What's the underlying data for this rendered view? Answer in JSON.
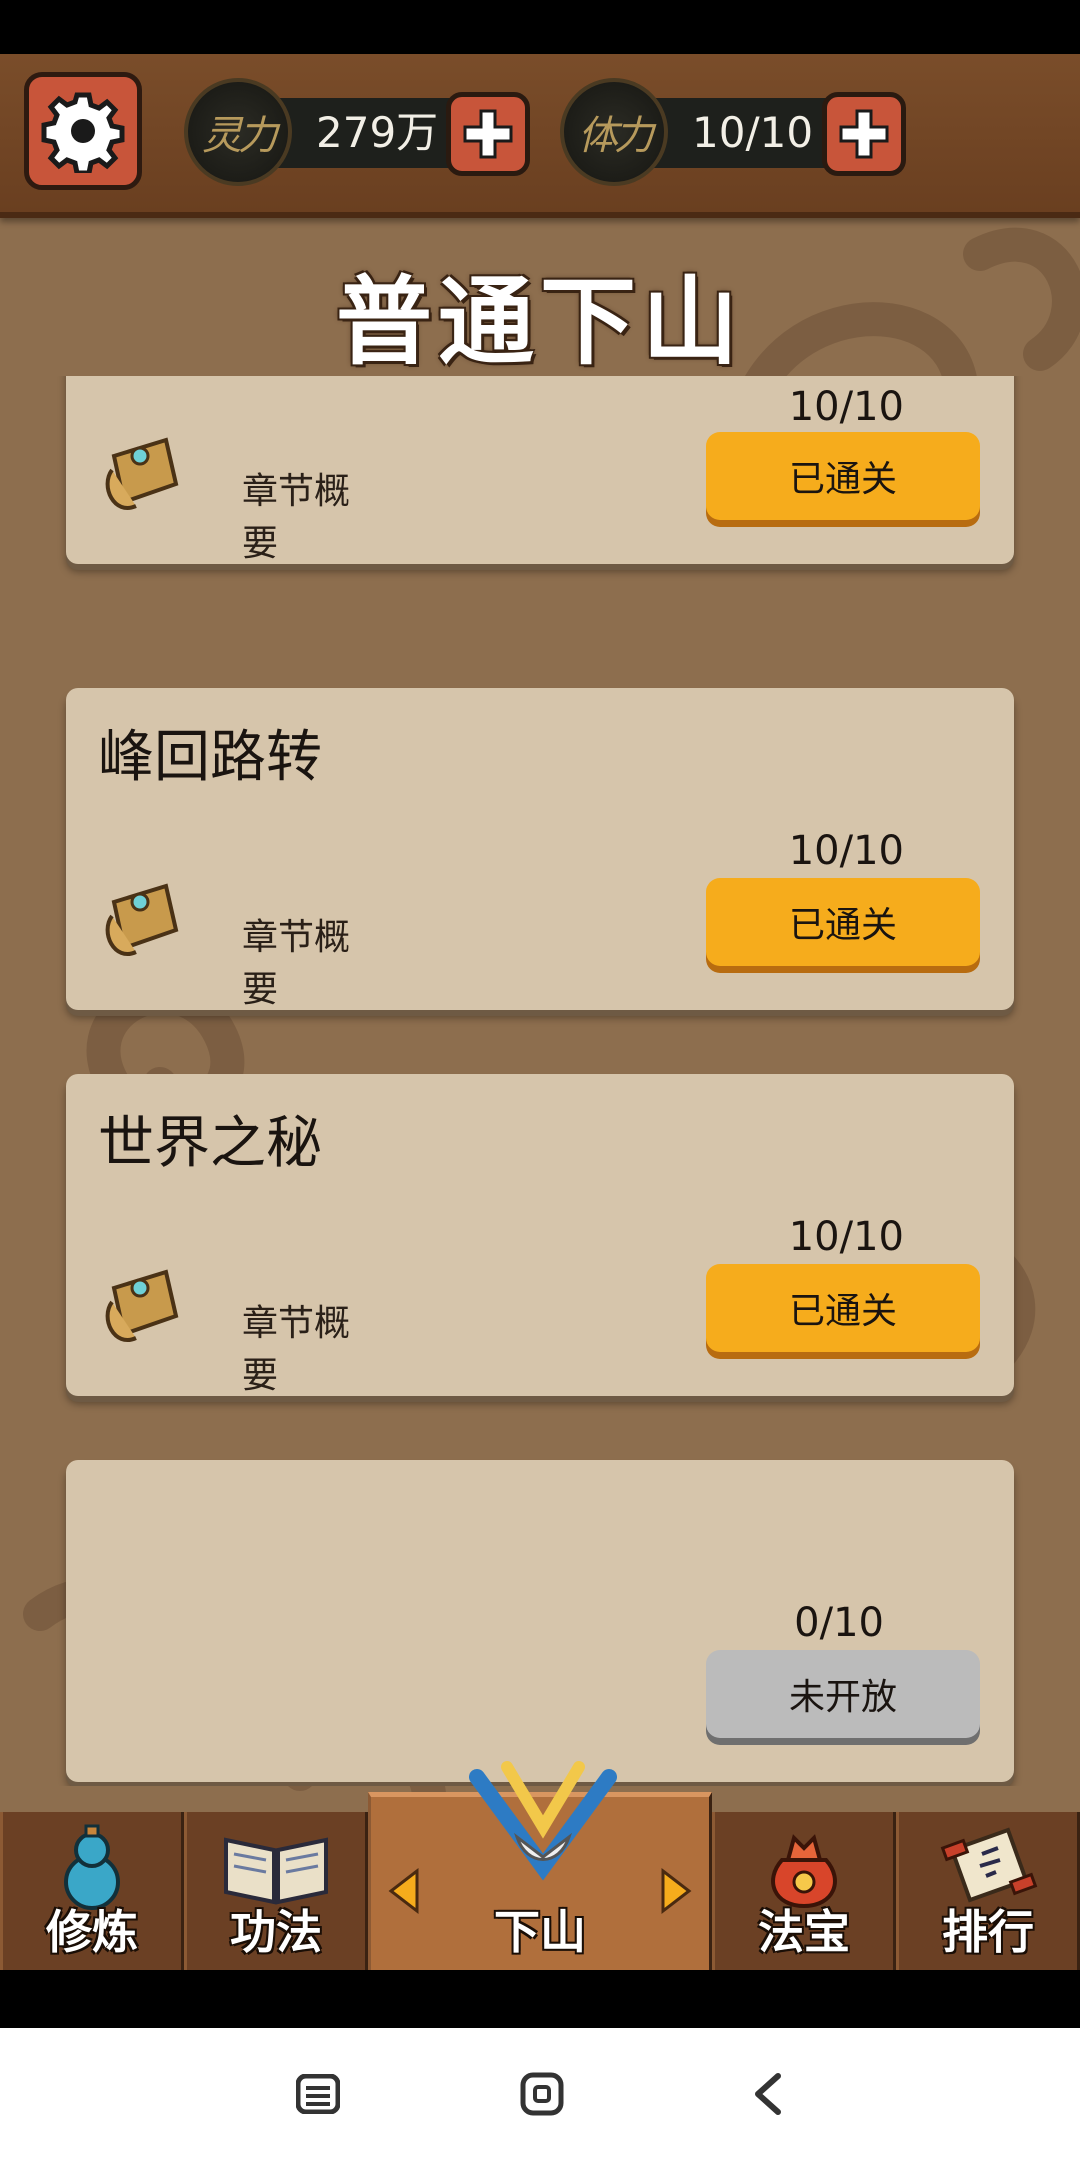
{
  "resources": [
    {
      "name": "灵力",
      "medal_text": "灵力",
      "value": "279万"
    },
    {
      "name": "体力",
      "medal_text": "体力",
      "value": "10/10"
    }
  ],
  "page_title": "普通下山",
  "chapters": [
    {
      "title": "",
      "progress": "10/10",
      "summary_label": "章节概要",
      "status": "已通关",
      "state": "done"
    },
    {
      "title": "峰回路转",
      "progress": "10/10",
      "summary_label": "章节概要",
      "status": "已通关",
      "state": "done"
    },
    {
      "title": "世界之秘",
      "progress": "10/10",
      "summary_label": "章节概要",
      "status": "已通关",
      "state": "done"
    },
    {
      "title": "",
      "progress": "0/10",
      "summary_label": "",
      "status": "未开放",
      "state": "locked"
    }
  ],
  "tabs": [
    {
      "label": "修炼",
      "icon": "gourd-icon"
    },
    {
      "label": "功法",
      "icon": "book-icon"
    },
    {
      "label": "下山",
      "icon": "crossed-blades-icon",
      "active": true
    },
    {
      "label": "法宝",
      "icon": "treasure-bag-icon"
    },
    {
      "label": "排行",
      "icon": "scroll-icon"
    }
  ],
  "colors": {
    "accent_button": "#f6ac1c",
    "locked_button": "#bbbbbb",
    "card": "#d6c5ab",
    "plus_button": "#c8553a"
  }
}
